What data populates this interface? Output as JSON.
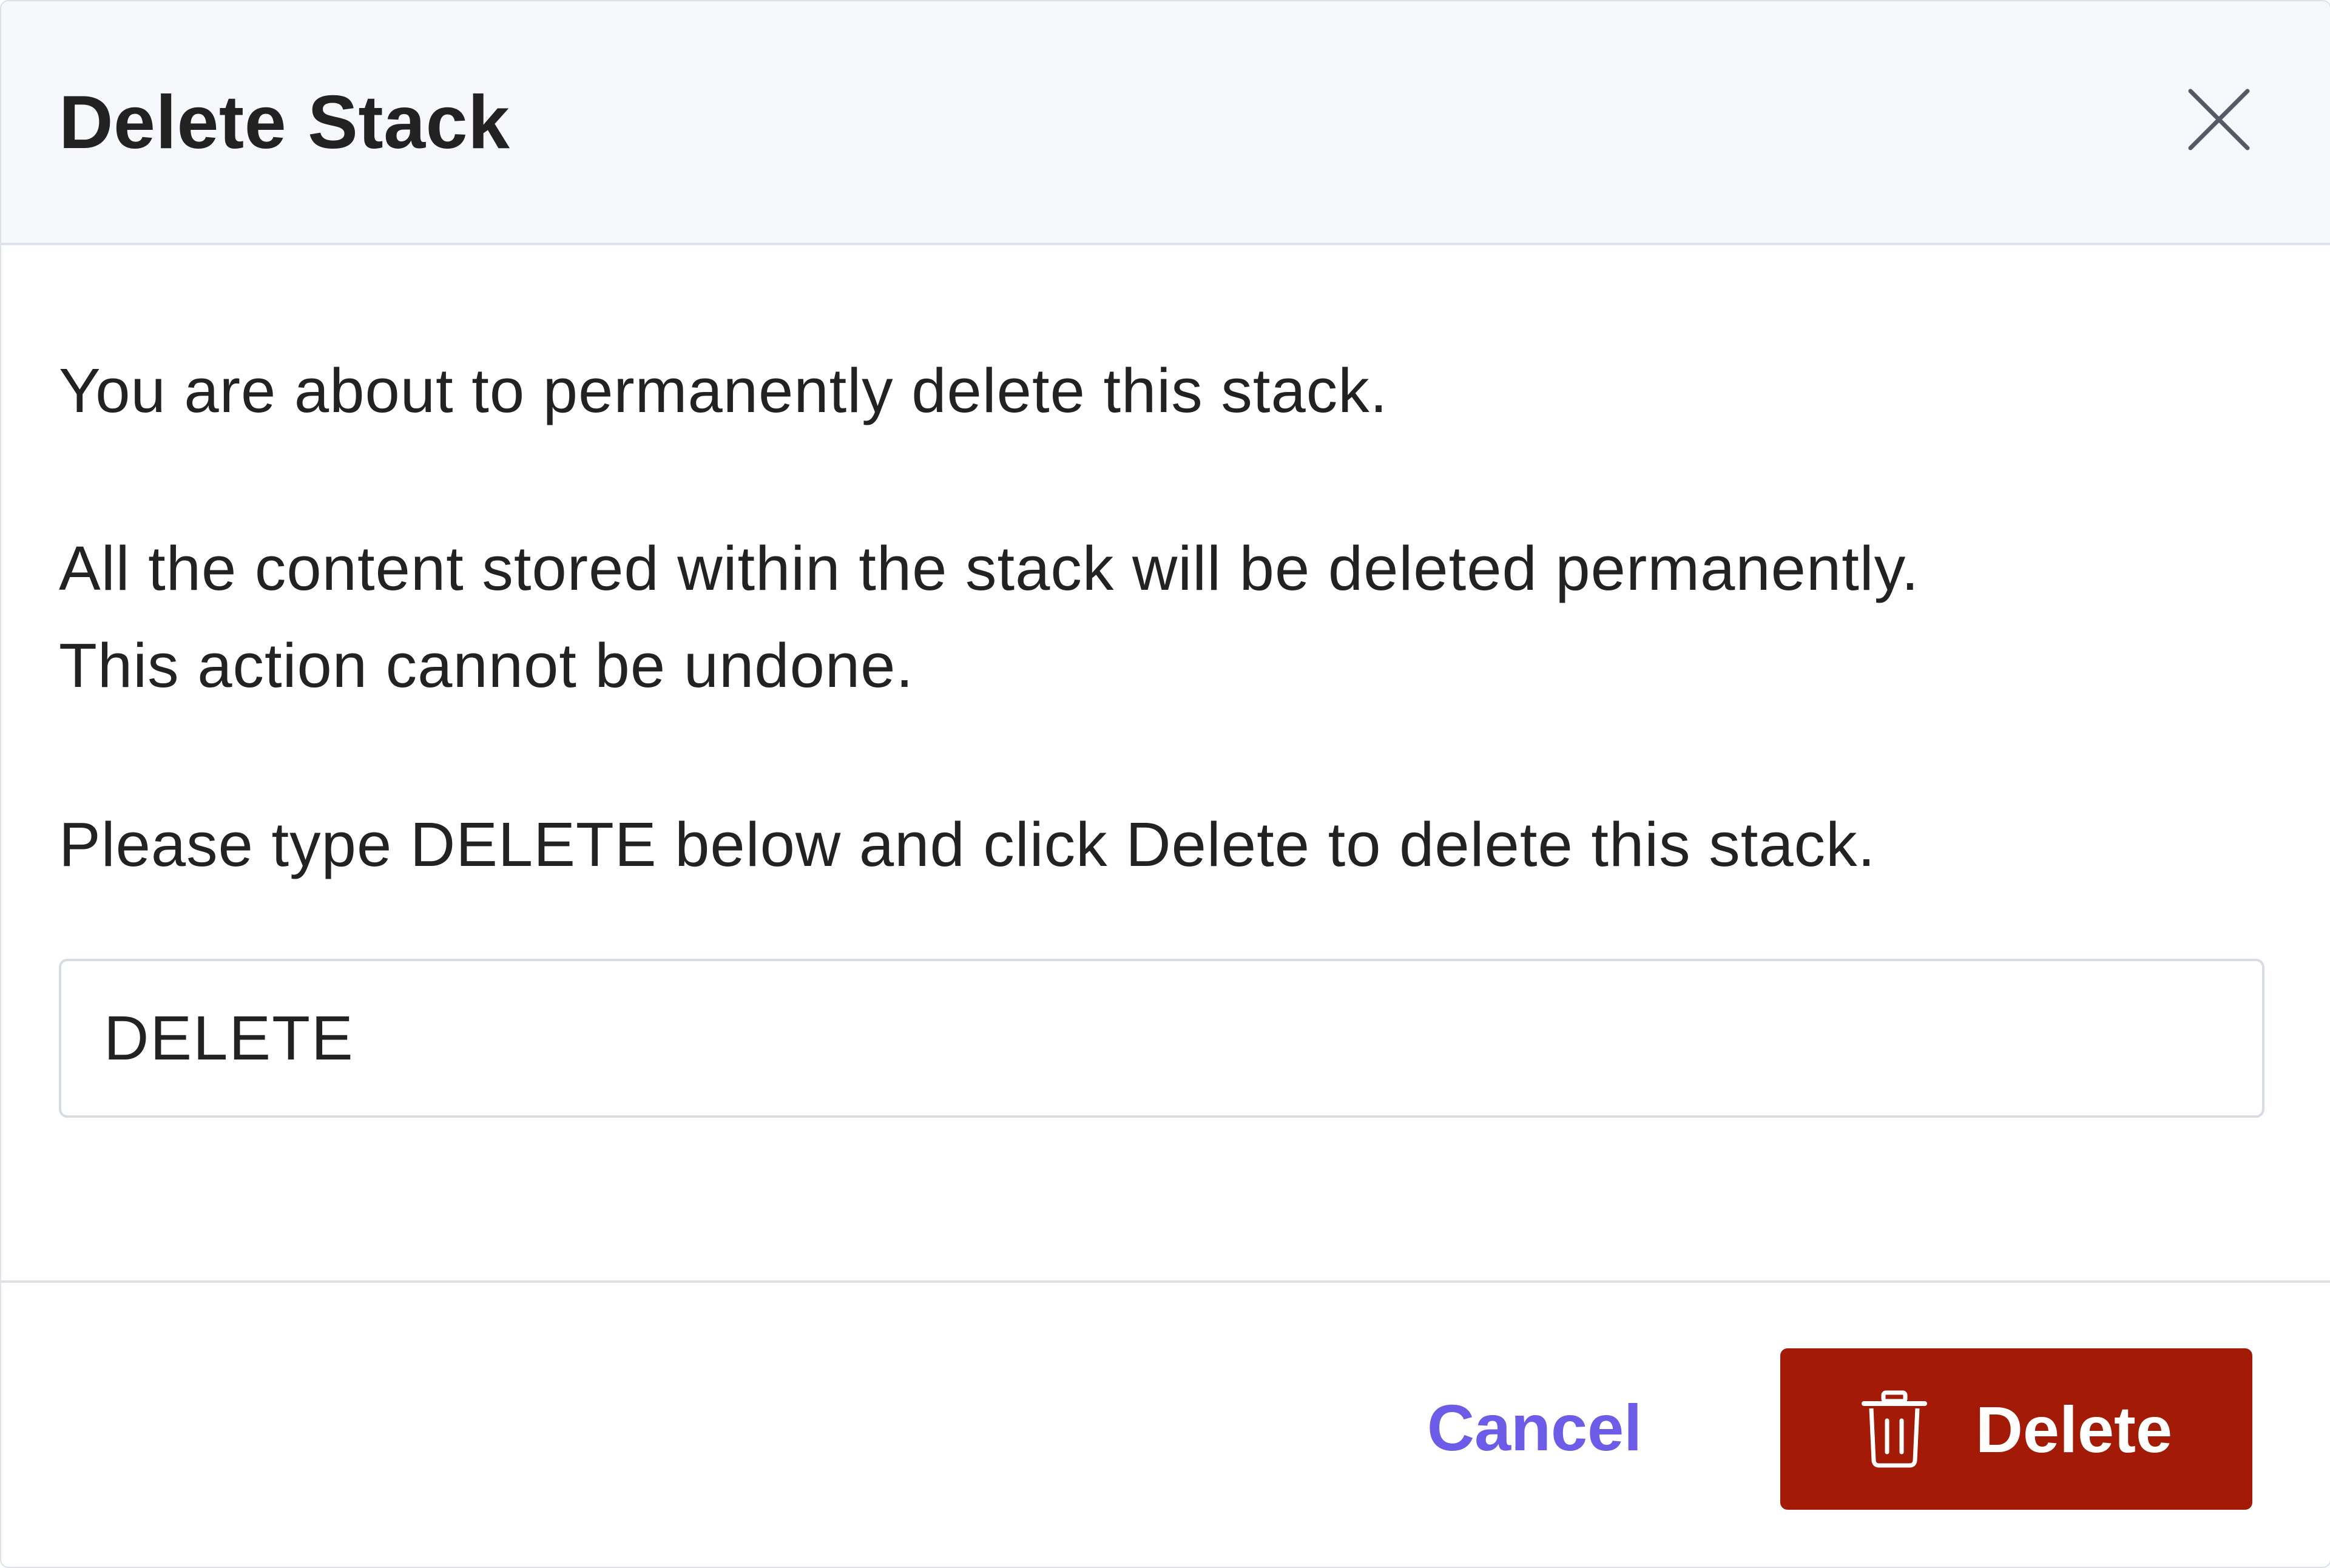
{
  "dialog": {
    "title": "Delete Stack",
    "close_icon": "close-icon"
  },
  "body": {
    "line1": "You are about to permanently delete this stack.",
    "line2": "All the content stored within the stack will be deleted permanently.",
    "line3": "This action cannot be undone.",
    "line4": "Please type DELETE below and click Delete to delete this stack."
  },
  "confirm_input": {
    "value": "DELETE",
    "placeholder": ""
  },
  "footer": {
    "cancel_label": "Cancel",
    "delete_label": "Delete",
    "delete_icon": "trash-icon"
  },
  "colors": {
    "danger": "#a31b07",
    "link": "#6c5ce7",
    "header_bg": "#f7f8fb",
    "border": "#dde1e8"
  }
}
